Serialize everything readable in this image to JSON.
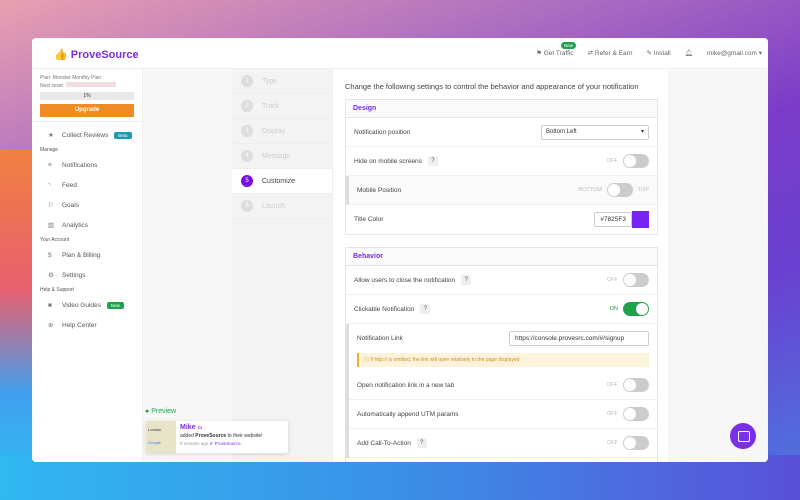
{
  "header": {
    "brand": "ProveSource",
    "get_traffic": "Get Traffic",
    "new_badge": "New",
    "refer": "Refer & Earn",
    "install": "Install",
    "account": "mike@gmail.com"
  },
  "sidebar": {
    "plan": "Plan: Monster Monthly Plan",
    "next_reset": "Next reset:",
    "usage": "1%",
    "usage_fraction": 0.01,
    "upgrade": "Upgrade",
    "collect_reviews": "Collect Reviews",
    "beta": "Beta",
    "manage": "Manage",
    "notifications": "Notifications",
    "feed": "Feed",
    "goals": "Goals",
    "analytics": "Analytics",
    "your_account": "Your Account",
    "plan_billing": "Plan & Billing",
    "settings": "Settings",
    "help_support": "Help & Support",
    "video_guides": "Video Guides",
    "new": "New",
    "help_center": "Help Center"
  },
  "steps": [
    {
      "n": "1",
      "label": "Type"
    },
    {
      "n": "2",
      "label": "Track"
    },
    {
      "n": "3",
      "label": "Display"
    },
    {
      "n": "4",
      "label": "Message"
    },
    {
      "n": "5",
      "label": "Customize"
    },
    {
      "n": "6",
      "label": "Launch"
    }
  ],
  "main": {
    "intro": "Change the following settings to control the behavior and appearance of your notification",
    "design": {
      "title": "Design",
      "position_label": "Notification position",
      "position_value": "Bottom Left",
      "hide_mobile": "Hide on mobile screens",
      "off": "OFF",
      "mobile_position": "Mobile Position",
      "bottom": "BOTTOM",
      "top": "TOP",
      "title_color": "Title Color",
      "title_color_value": "#7825F3"
    },
    "behavior": {
      "title": "Behavior",
      "allow_close": "Allow users to close the notification",
      "clickable": "Clickable Notification",
      "on": "ON",
      "off": "OFF",
      "link_label": "Notification Link",
      "link_value": "https://console.provesrc.com/#/signup",
      "warning": "If http:// is omitted, the link will open relatively to the page displayed",
      "new_tab": "Open notification link in a new tab",
      "utm": "Automatically append UTM params",
      "cta": "Add Call-To-Action"
    }
  },
  "preview": {
    "label": "Preview",
    "map_label": "London",
    "map_brand": "Google",
    "name": "Mike",
    "text_pre": "added",
    "text_bold": "ProveSource",
    "text_post": "to their website!",
    "time": "8 minutes ago",
    "verified": "ProveSource"
  }
}
